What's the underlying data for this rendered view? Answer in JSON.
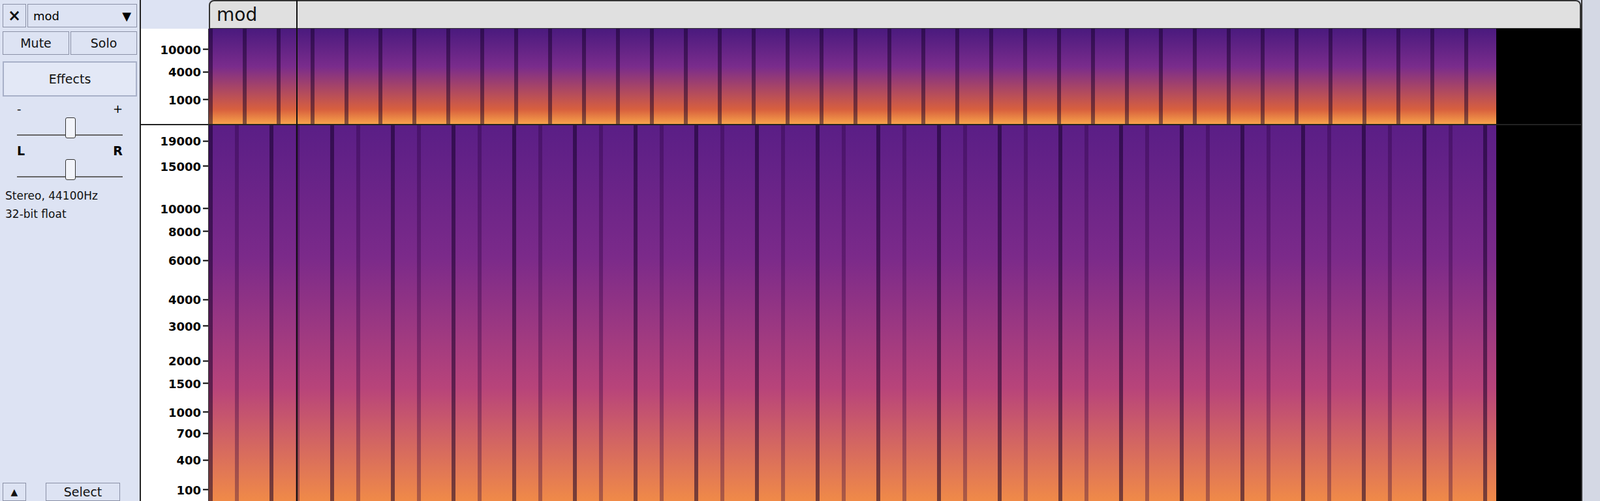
{
  "track": {
    "close": "×",
    "name": "mod",
    "menu_arrow": "▼",
    "title": "mod"
  },
  "buttons": [
    {
      "label": "Mute",
      "selected": false
    },
    {
      "label": "Solo",
      "selected": false
    }
  ],
  "effects": "Effects",
  "gain": {
    "minus": "-",
    "plus": "+",
    "level": 0.5
  },
  "pan": {
    "left": "L",
    "right": "R",
    "level": 0.5
  },
  "info": [
    "Stereo, 44100Hz",
    "32-bit float"
  ],
  "collapse": "▲",
  "select": "Select",
  "channels": [
    {
      "ticks": [
        "10000",
        "4000",
        "1000"
      ]
    },
    {
      "ticks": [
        "19000",
        "15000",
        "10000",
        "8000",
        "6000",
        "4000",
        "3000",
        "2000",
        "1500",
        "1000",
        "700",
        "400",
        "100"
      ]
    }
  ]
}
